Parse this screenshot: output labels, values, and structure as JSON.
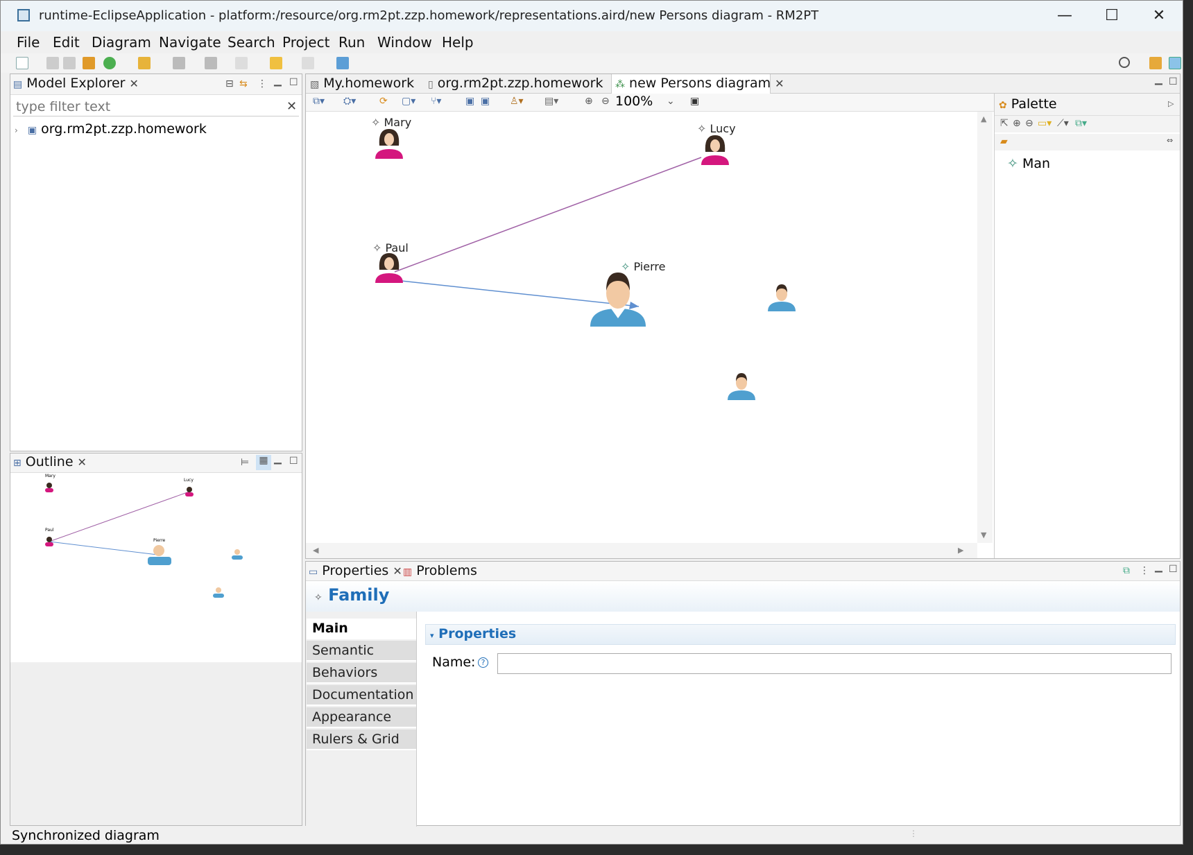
{
  "window": {
    "title": "runtime-EclipseApplication - platform:/resource/org.rm2pt.zzp.homework/representations.aird/new Persons diagram - RM2PT",
    "minimize": "—",
    "maximize": "☐",
    "close": "✕"
  },
  "menu": [
    "File",
    "Edit",
    "Diagram",
    "Navigate",
    "Search",
    "Project",
    "Run",
    "Window",
    "Help"
  ],
  "model_explorer": {
    "tab": "Model Explorer",
    "filter_placeholder": "type filter text",
    "tree_item": "org.rm2pt.zzp.homework"
  },
  "outline": {
    "tab": "Outline",
    "labels": {
      "mary": "Mary",
      "lucy": "Lucy",
      "paul": "Paul",
      "pierre": "Pierre"
    }
  },
  "editor": {
    "tabs": [
      "My.homework",
      "org.rm2pt.zzp.homework",
      "new Persons diagram"
    ],
    "zoom": "100%"
  },
  "diagram": {
    "nodes": {
      "mary": "Mary",
      "lucy": "Lucy",
      "paul": "Paul",
      "pierre": "Pierre"
    }
  },
  "palette": {
    "title": "Palette",
    "items": [
      "Man"
    ]
  },
  "properties": {
    "tabs": [
      "Properties",
      "Problems"
    ],
    "heading": "Family",
    "categories": [
      "Main",
      "Semantic",
      "Behaviors",
      "Documentation",
      "Appearance",
      "Rulers & Grid"
    ],
    "section": "Properties",
    "name_label": "Name:",
    "name_value": ""
  },
  "status": "Synchronized diagram",
  "colors": {
    "woman": "#d4177e",
    "man_shirt": "#4f9fcf",
    "edge_purple": "#a061a6",
    "edge_blue": "#5f8fd0"
  }
}
